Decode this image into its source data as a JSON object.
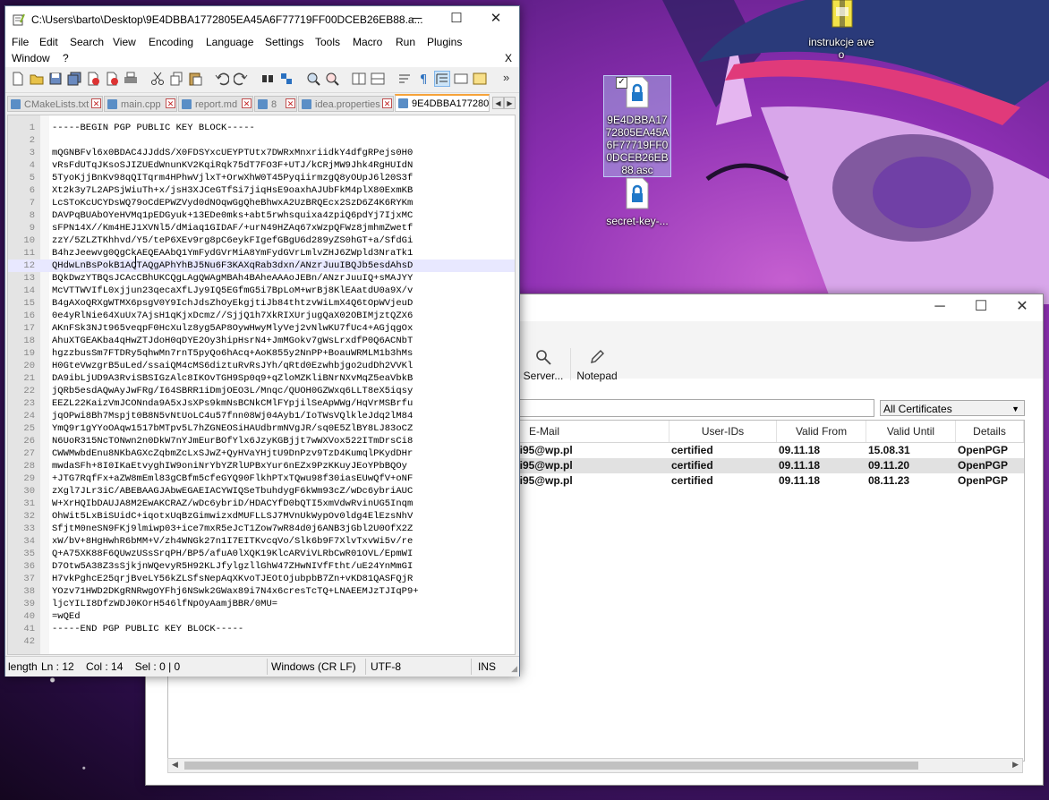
{
  "desktop": {
    "icons": [
      {
        "label": "instrukcje aveo",
        "selected": false
      },
      {
        "label": "9E4DBBA1772805EA45A6F77719FF00DCEB26EB88.asc",
        "selected": true
      },
      {
        "label": "secret-key-...",
        "selected": false
      }
    ]
  },
  "kleopatra": {
    "toolbar": [
      {
        "label": "Server...",
        "icon": "server-search-icon"
      },
      {
        "label": "Notepad",
        "icon": "notepad-pen-icon"
      }
    ],
    "search": {
      "value": ""
    },
    "filter": {
      "selected": "All Certificates"
    },
    "columns": [
      "E-Mail",
      "User-IDs",
      "Valid From",
      "Valid Until",
      "Details"
    ],
    "rows": [
      {
        "email": "ki95@wp.pl",
        "userids": "certified",
        "valid_from": "09.11.18",
        "valid_until": "15.08.31",
        "details": "OpenPGP",
        "selected": false
      },
      {
        "email": "ki95@wp.pl",
        "userids": "certified",
        "valid_from": "09.11.18",
        "valid_until": "09.11.20",
        "details": "OpenPGP",
        "selected": true
      },
      {
        "email": "ki95@wp.pl",
        "userids": "certified",
        "valid_from": "09.11.18",
        "valid_until": "08.11.23",
        "details": "OpenPGP",
        "selected": false
      }
    ]
  },
  "notepadpp": {
    "title": "C:\\Users\\barto\\Desktop\\9E4DBBA1772805EA45A6F77719FF00DCEB26EB88.a...",
    "menu": [
      "File",
      "Edit",
      "Search",
      "View",
      "Encoding",
      "Language",
      "Settings",
      "Tools",
      "Macro",
      "Run",
      "Plugins",
      "Window",
      "?"
    ],
    "menu_close": "X",
    "tabs": [
      {
        "label": "CMakeLists.txt",
        "active": false
      },
      {
        "label": "main.cpp",
        "active": false
      },
      {
        "label": "report.md",
        "active": false
      },
      {
        "label": "8",
        "active": false
      },
      {
        "label": "idea.properties",
        "active": false
      },
      {
        "label": "9E4DBBA177280",
        "active": true
      }
    ],
    "current_line": 12,
    "lines": [
      "-----BEGIN PGP PUBLIC KEY BLOCK-----",
      "",
      "mQGNBFvl6x0BDAC4JJddS/X0FDSYxcUEYPTUtx7DWRxMnxriidkY4dfgRPejs0H0",
      "vRsFdUTqJKsoSJIZUEdWnunKV2KqiRqk75dT7FO3F+UTJ/kCRjMW9Jhk4RgHUIdN",
      "5TyoKjjBnKv98qQITqrm4HPhwVjlxT+OrwXhW0T45PyqiirmzgQ8yOUpJ6l20S3f",
      "Xt2k3y7L2APSjWiuTh+x/jsH3XJCeGTfSi7jiqHsE9oaxhAJUbFkM4plX80ExmKB",
      "LcSToKcUCYDsWQ79oCdEPWZVyd0dNOqwGgQheBhwxA2UzBRQEcx2SzD6Z4K6RYKm",
      "DAVPqBUAbOYeHVMq1pEDGyuk+13EDe0mks+abt5rwhsquixa4zpiQ6pdYj7IjxMC",
      "sFPN14X//Km4HEJ1XVNl5/dMiaq1GIDAF/+urN49HZAq67xWzpQFWz8jmhmZwetf",
      "zzY/5ZLZTKhhvd/Y5/teP6XEv9rg8pC6eykFIgefGBgU6d289yZS0hGT+a/SfdGi",
      "B4hzJeewvg0QgCkAEQEAAbQ1YmFydGVrMiA8YmFydGVrLmlvZHJ6ZWpld3NraTk1",
      "QHdwLnBsPokB1AQTAQgAPhYhBJ5Nu6F3KAXqRab3dxn/ANzrJuuIBQJb5esdAhsD",
      "BQkDwzYTBQsJCAcCBhUKCQgLAgQWAgMBAh4BAheAAAoJEBn/ANzrJuuIQ+sMAJYY",
      "McVTTWVIfL0xjjun23qecaXfLJy9IQ5EGfmG5i7BpLoM+wrBj8KlEAatdU0a9X/v",
      "B4gAXoQRXgWTMX6psgV0Y9IchJdsZhOyEkgjtiJb84thtzvWiLmX4Q6tOpWVjeuD",
      "0e4yRlNie64XuUx7AjsH1qKjxDcmz//SjjQ1h7XkRIXUrjugQaX02OBIMjztQZX6",
      "AKnFSk3NJt965veqpF0HcXulz8yg5AP8OywHwyMlyVej2vNlwKU7fUc4+AGjqgOx",
      "AhuXTGEAKba4qHwZTJdoH0qDYE2Oy3hipHsrN4+JmMGokv7gWsLrxdfP0Q6ACNbT",
      "hgzzbusSm7FTDRy5qhwMn7rnT5pyQo6hAcq+AoK855y2NnPP+BoauWRMLM1b3hMs",
      "H0GteVwzgrB5uLed/ssaiQM4cMS6diztuRvRsJYh/qRtd0Ezwhbjgo2udDh2VVKl",
      "DA9ibLjUD9A3RviSBSIGzAlc8IKOvTGH9Sp0q9+qZloMZKliBNrNXvMqZ5eaVbkB",
      "jQRb5esdAQwAyJwFRg/I64SBRR1iDmjOEO3L/Mnqc/QUOH0GZWxq6LLT8eX5iqsy",
      "EEZL22KaizVmJCONnda9A5xJsXPs9kmNsBCNkCMlFYpjilSeApWWg/HqVrMSBrfu",
      "jqOPwi8Bh7Mspjt0B8N5vNtUoLC4u57fnn08Wj04Ayb1/IoTWsVQlkleJdq2lM84",
      "YmQ9r1gYYoOAqw1517bMTpv5L7hZGNEOSiHAUdbrmNVgJR/sq0E5ZlBY8LJ83oCZ",
      "N6UoR315NcTONwn2n0DkW7nYJmEurBOfYlx6JzyKGBjjt7wWXVox522ITmDrsCi8",
      "CWWMwbdEnu8NKbAGXcZqbmZcLxSJwZ+QyHVaYHjtU9DnPzv9TzD4KumqlPKydDHr",
      "mwdaSFh+8I0IKaEtvyghIW9oniNrYbYZRlUPBxYur6nEZx9PzKKuyJEoYPbBQOy",
      "+JTG7RqfFx+aZW8mEml83gCBfm5cfeGYQ90FlkhPTxTQwu98f30iasEUwQfV+oNF",
      "zXgl7JLr3iC/ABEBAAGJAbwEGAEIACYWIQSeTbuhdygF6kWm93cZ/wDc6ybriAUC",
      "W+XrHQIbDAUJA8M2EwAKCRAZ/wDc6ybriD/HDACYfD0bQTI5xmVdwRvinUG5Inqm",
      "OhWit5LxBiSUidC+iqotxUqBzGimwizxdMUFLLSJ7MVnUkWypOv0ldg4ElEzsNhV",
      "SfjtM0neSN9FKj9lmiwp03+ice7mxR5eJcT1Zow7wR84d0j6ANB3jGbl2U0OfX2Z",
      "xW/bV+8HgHwhR6bMM+V/zh4WNGk27n1I7EITKvcqVo/Slk6b9F7XlvTxvWi5v/re",
      "Q+A75XK88F6QUwzUSsSrqPH/BP5/afuA0lXQK19KlcARViVLRbCwR01OVL/EpmWI",
      "D7Otw5A38Z3sSjkjnWQevyR5H92KLJfylgzllGhW47ZHwNIVfFtht/uE24YnMmGI",
      "H7vkPghcE25qrjBveLY56kZLSfsNepAqXKvoTJEOtOjubpbB7Zn+vKD81QASFQjR",
      "YOzv71HWD2DKgRNRwgOYFhj6NSwk2GWax89i7N4x6cresTcTQ+LNAEEMJzTJIqP9+",
      "ljcYILI8DfzWDJ0KOrH546lfNpOyAamjBBR/0MU=",
      "=wQEd",
      "-----END PGP PUBLIC KEY BLOCK-----",
      ""
    ],
    "status": {
      "length": "length",
      "position": "Ln : 12    Col : 14    Sel : 0 | 0",
      "eol": "Windows (CR LF)",
      "encoding": "UTF-8",
      "mode": "INS"
    }
  },
  "colors": {
    "accent_tab": "#f6a33a",
    "current_line": "#e8e8ff",
    "tab_close": "#c02020"
  }
}
